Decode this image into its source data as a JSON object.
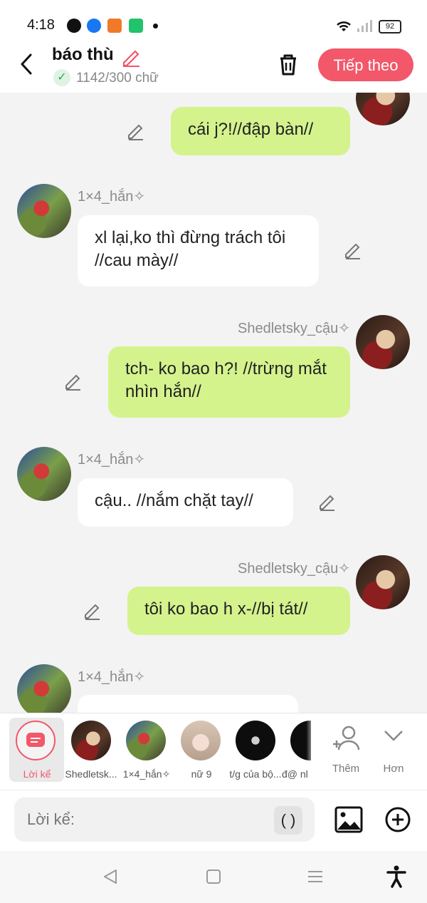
{
  "status": {
    "time": "4:18",
    "battery": "92"
  },
  "header": {
    "title": "báo thù",
    "word_count": "1142/300 chữ",
    "next_label": "Tiếp theo"
  },
  "messages": [
    {
      "text": "cái j?!//đập bàn//"
    },
    {
      "name": "1×4_hắn✧",
      "text": "xl lại,ko thì đừng trách tôi //cau mày//"
    },
    {
      "name": "Shedletsky_cậu✧",
      "text": "tch- ko bao h?! //trừng mắt nhìn hắn//"
    },
    {
      "name": "1×4_hắn✧",
      "text": "cậu.. //nắm chặt tay//"
    },
    {
      "name": "Shedletsky_cậu✧",
      "text": "tôi ko bao h x-//bị tát//"
    },
    {
      "name": "1×4_hắn✧"
    }
  ],
  "characters": [
    {
      "label": "Lời kể"
    },
    {
      "label": "Shedletsk..."
    },
    {
      "label": "1×4_hắn✧"
    },
    {
      "label": "nữ 9"
    },
    {
      "label": "t/g của bộ..."
    },
    {
      "label": "đ@ nl"
    }
  ],
  "actions": {
    "add_label": "Thêm",
    "more_label": "Hơn"
  },
  "composer": {
    "placeholder": "Lời kể:",
    "paren": "( )"
  },
  "colors": {
    "accent": "#f2576a",
    "my_bubble": "#d4f38d",
    "their_bubble": "#ffffff"
  }
}
